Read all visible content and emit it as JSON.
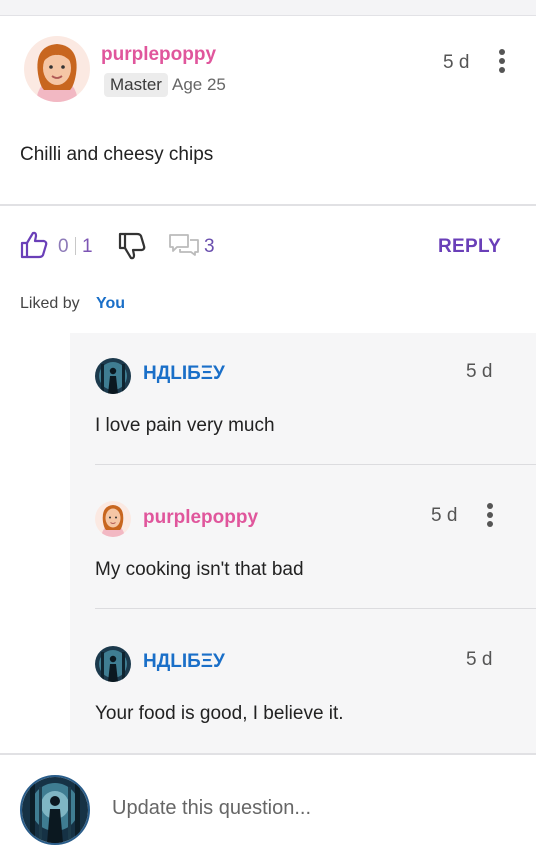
{
  "post": {
    "username": "purplepoppy",
    "badge": "Master",
    "age": "Age 25",
    "time": "5 d",
    "text": "Chilli and cheesy chips"
  },
  "actions": {
    "likes": "0",
    "liked": "1",
    "comments": "3",
    "reply_label": "REPLY"
  },
  "liked_by": {
    "label": "Liked by",
    "who": "You"
  },
  "replies": [
    {
      "username": "НДLIБΞУ",
      "time": "5 d",
      "text": "I love pain very much"
    },
    {
      "username": "purplepoppy",
      "time": "5 d",
      "text": "My cooking isn't that bad"
    },
    {
      "username": "НДLIБΞУ",
      "time": "5 d",
      "text": "Your food is good, I believe it."
    }
  ],
  "composer": {
    "placeholder": "Update this question..."
  },
  "colors": {
    "pink_username": "#e0569c",
    "blue_username": "#1a6fc8",
    "accent_purple": "#6a3fb8"
  }
}
